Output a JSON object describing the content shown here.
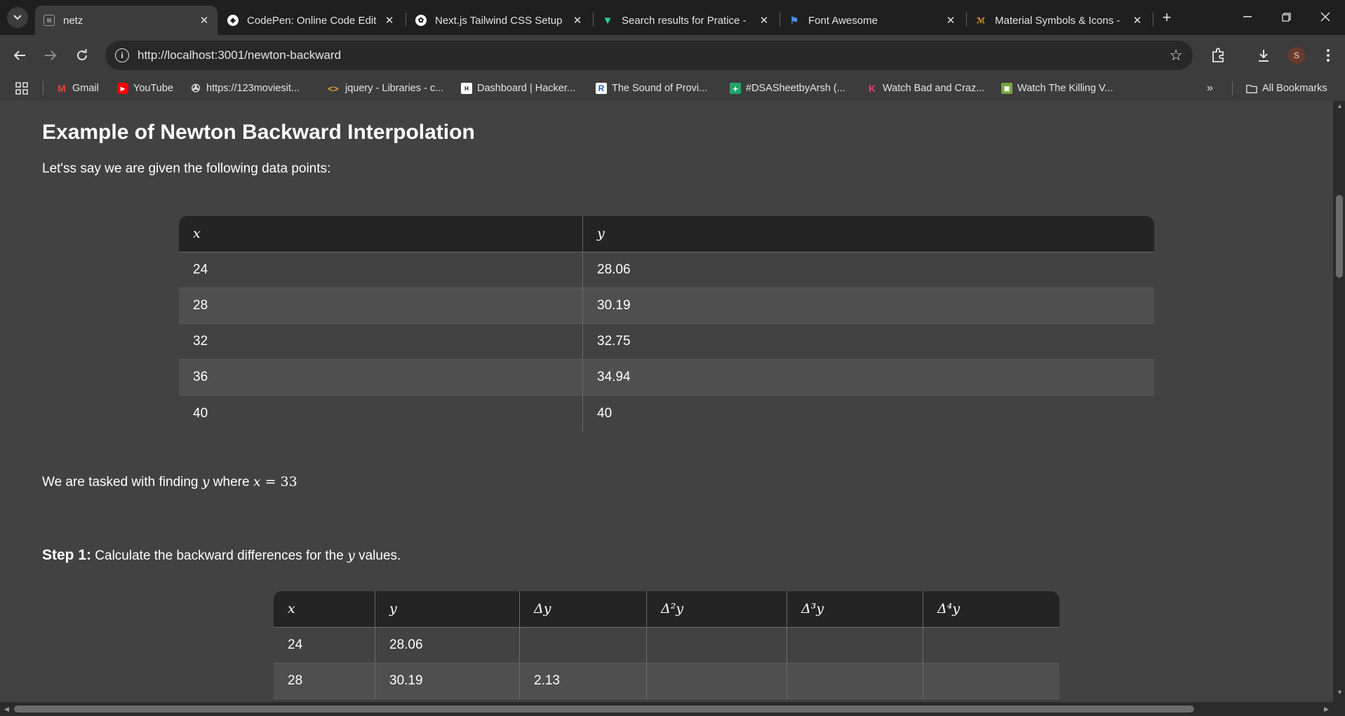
{
  "tabs": [
    {
      "title": "netz",
      "active": true
    },
    {
      "title": "CodePen: Online Code Edit"
    },
    {
      "title": "Next.js Tailwind CSS Setup"
    },
    {
      "title": "Search results for Pratice -"
    },
    {
      "title": "Font Awesome"
    },
    {
      "title": "Material Symbols & Icons -"
    }
  ],
  "address": {
    "url": "http://localhost:3001/newton-backward"
  },
  "profile": {
    "initial": "S"
  },
  "bookmarks": [
    {
      "label": "Gmail"
    },
    {
      "label": "YouTube"
    },
    {
      "label": "https://123moviesit..."
    },
    {
      "label": "jquery - Libraries - c..."
    },
    {
      "label": "Dashboard | Hacker..."
    },
    {
      "label": "The Sound of Provi..."
    },
    {
      "label": "#DSASheetbyArsh (..."
    },
    {
      "label": "Watch Bad and Craz..."
    },
    {
      "label": "Watch The Killing V..."
    }
  ],
  "all_bookmarks": "All Bookmarks",
  "content": {
    "heading": "Example of Newton Backward Interpolation",
    "intro": "Let'ss say we are given the following data points:",
    "table1": {
      "headers": [
        "x",
        "y"
      ],
      "rows": [
        [
          "24",
          "28.06"
        ],
        [
          "28",
          "30.19"
        ],
        [
          "32",
          "32.75"
        ],
        [
          "36",
          "34.94"
        ],
        [
          "40",
          "40"
        ]
      ]
    },
    "task": {
      "prefix": "We are tasked with finding ",
      "var_y": "y",
      "middle": " where ",
      "var_x": "x",
      "eq": " = 33"
    },
    "step1": {
      "label": "Step 1:",
      "text_a": " Calculate the backward differences for the ",
      "var": "y",
      "text_b": " values."
    },
    "table2": {
      "headers": [
        "x",
        "y",
        "Δy",
        "Δ²y",
        "Δ³y",
        "Δ⁴y"
      ],
      "rows": [
        [
          "24",
          "28.06",
          "",
          "",
          "",
          ""
        ],
        [
          "28",
          "30.19",
          "2.13",
          "",
          "",
          ""
        ]
      ]
    }
  }
}
